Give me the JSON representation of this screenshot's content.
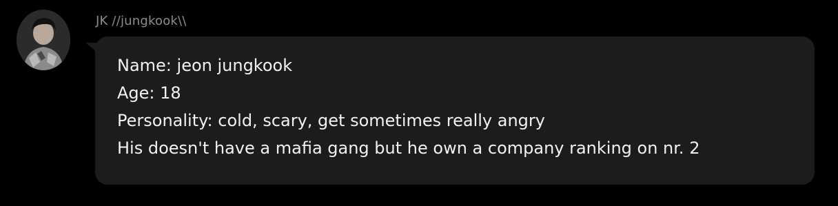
{
  "message": {
    "sender_name": "JK //jungkook\\\\",
    "avatar_icon": "user-avatar-photo",
    "bubble_color": "#1c1c1c",
    "lines": [
      "Name: jeon jungkook",
      "Age: 18",
      "Personality: cold, scary, get sometimes really angry",
      "His doesn't have a mafia gang but he own a company ranking on nr. 2"
    ]
  }
}
